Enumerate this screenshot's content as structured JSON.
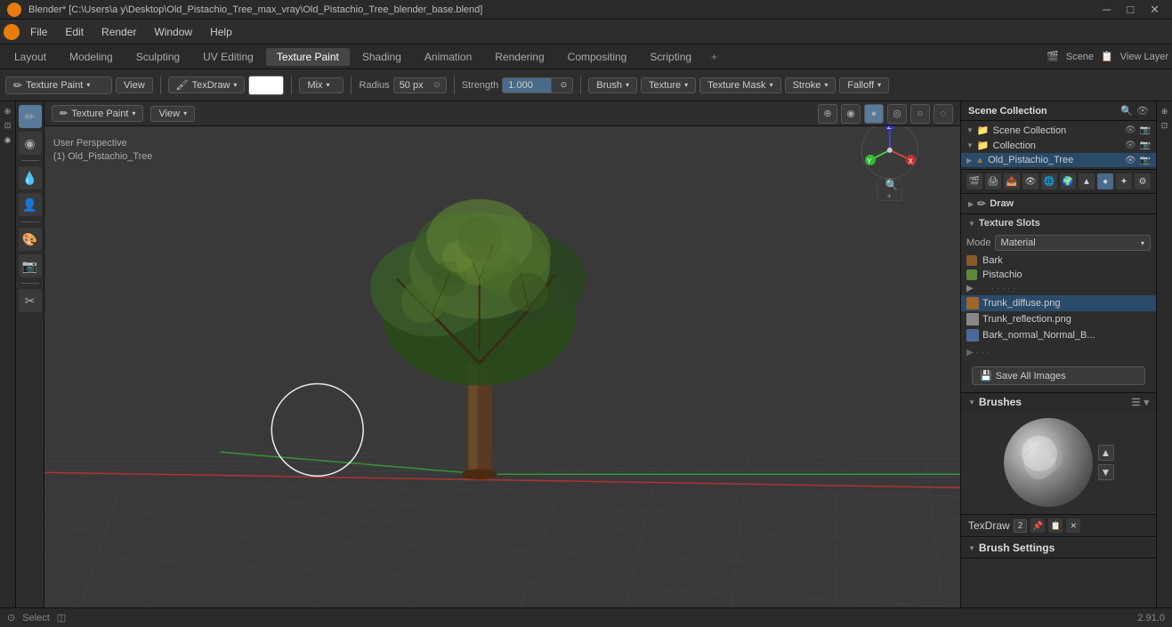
{
  "titlebar": {
    "title": "Blender* [C:\\Users\\a y\\Desktop\\Old_Pistachio_Tree_max_vray\\Old_Pistachio_Tree_blender_base.blend]",
    "controls": [
      "─",
      "□",
      "✕"
    ]
  },
  "menubar": {
    "items": [
      "Blender",
      "File",
      "Edit",
      "Render",
      "Window",
      "Help"
    ]
  },
  "workspace_tabs": {
    "tabs": [
      "Layout",
      "Modeling",
      "Sculpting",
      "UV Editing",
      "Texture Paint",
      "Shading",
      "Animation",
      "Rendering",
      "Compositing",
      "Scripting"
    ],
    "active": "Texture Paint",
    "add_btn": "+",
    "right_section": {
      "scene_label": "Scene",
      "scene_value": "Scene",
      "view_layer_label": "View Layer",
      "view_layer_value": "View Layer"
    }
  },
  "toolbar": {
    "mode_label": "Texture Paint",
    "view_btn": "View",
    "brush_name": "TexDraw",
    "color_label": "Color",
    "blend_mode": "Mix",
    "radius_label": "Radius",
    "radius_value": "50 px",
    "strength_label": "Strength",
    "strength_value": "1.000",
    "brush_btn": "Brush",
    "texture_btn": "Texture",
    "texture_mask_btn": "Texture Mask",
    "stroke_btn": "Stroke",
    "falloff_btn": "Falloff"
  },
  "viewport": {
    "view_info_line1": "User Perspective",
    "view_info_line2": "(1) Old_Pistachio_Tree",
    "mode_btn": "Texture Paint",
    "view_btn": "View"
  },
  "left_tools": {
    "tools": [
      "✏",
      "◉",
      "💧",
      "👤",
      "🎨",
      "📷",
      "✂"
    ]
  },
  "outliner": {
    "title": "Scene Collection",
    "items": [
      {
        "label": "Scene Collection",
        "icon": "📁",
        "level": 0,
        "expand": true
      },
      {
        "label": "Collection",
        "icon": "📁",
        "level": 1,
        "expand": true
      },
      {
        "label": "Old_Pistachio_Tree",
        "icon": "🌲",
        "level": 2,
        "selected": true
      }
    ]
  },
  "properties": {
    "draw_label": "Draw",
    "texture_slots_label": "Texture Slots",
    "mode_label": "Mode",
    "mode_value": "Material",
    "slots": [
      {
        "name": "Bark",
        "color": "#7a5a2a",
        "type": "material"
      },
      {
        "name": "Pistachio",
        "color": "#4a7a3a",
        "type": "material"
      }
    ],
    "textures": [
      {
        "name": "Trunk_diffuse.png",
        "thumb": "brown",
        "selected": true
      },
      {
        "name": "Trunk_reflection.png",
        "thumb": "gray"
      },
      {
        "name": "Bark_normal_Normal_B...",
        "thumb": "blue"
      }
    ],
    "save_images_label": "Save All Images",
    "brushes_label": "Brushes",
    "brush_name": "TexDraw",
    "brush_num": "2",
    "brush_settings_label": "Brush Settings"
  },
  "statusbar": {
    "left": "Select",
    "icons": [
      "⊙",
      "◫"
    ],
    "version": "2.91.0"
  },
  "icons": {
    "expand_arrow": "▶",
    "collapse_arrow": "▼",
    "eye": "👁",
    "plus": "+",
    "minus": "–",
    "settings": "⚙",
    "search": "🔍",
    "camera": "📷",
    "render": "🎬",
    "material": "●",
    "object": "○",
    "dropdown": "▾",
    "check": "✓",
    "link": "🔗"
  },
  "colors": {
    "active_tab": "#464646",
    "selected_row": "#2a4a6a",
    "accent_blue": "#5a7a9a",
    "bark_color": "#8a5a2a",
    "pistachio_color": "#5a8a3a"
  }
}
